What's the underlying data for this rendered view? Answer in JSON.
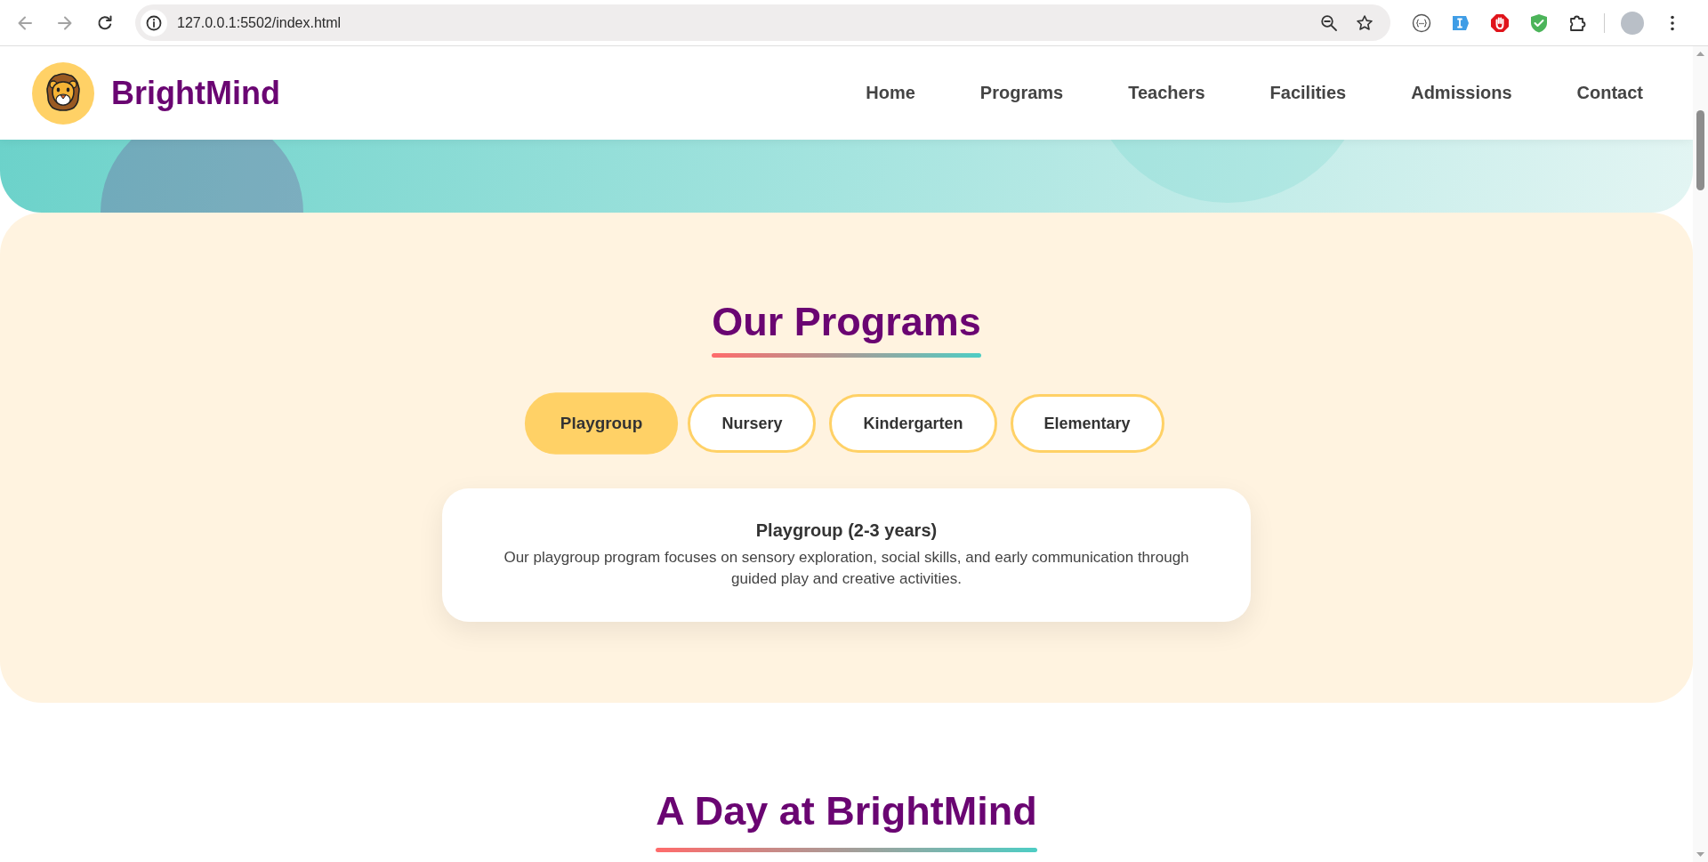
{
  "browser": {
    "url": "127.0.0.1:5502/index.html"
  },
  "header": {
    "brand": "BrightMind",
    "nav": [
      {
        "label": "Home"
      },
      {
        "label": "Programs"
      },
      {
        "label": "Teachers"
      },
      {
        "label": "Facilities"
      },
      {
        "label": "Admissions"
      },
      {
        "label": "Contact"
      }
    ]
  },
  "programs": {
    "title": "Our Programs",
    "tabs": [
      {
        "label": "Playgroup",
        "selected": true
      },
      {
        "label": "Nursery",
        "selected": false
      },
      {
        "label": "Kindergarten",
        "selected": false
      },
      {
        "label": "Elementary",
        "selected": false
      }
    ],
    "card": {
      "title": "Playgroup (2-3 years)",
      "text": "Our playgroup program focuses on sensory exploration, social skills, and early communication through guided play and creative activities."
    }
  },
  "day_section": {
    "title": "A Day at BrightMind"
  }
}
